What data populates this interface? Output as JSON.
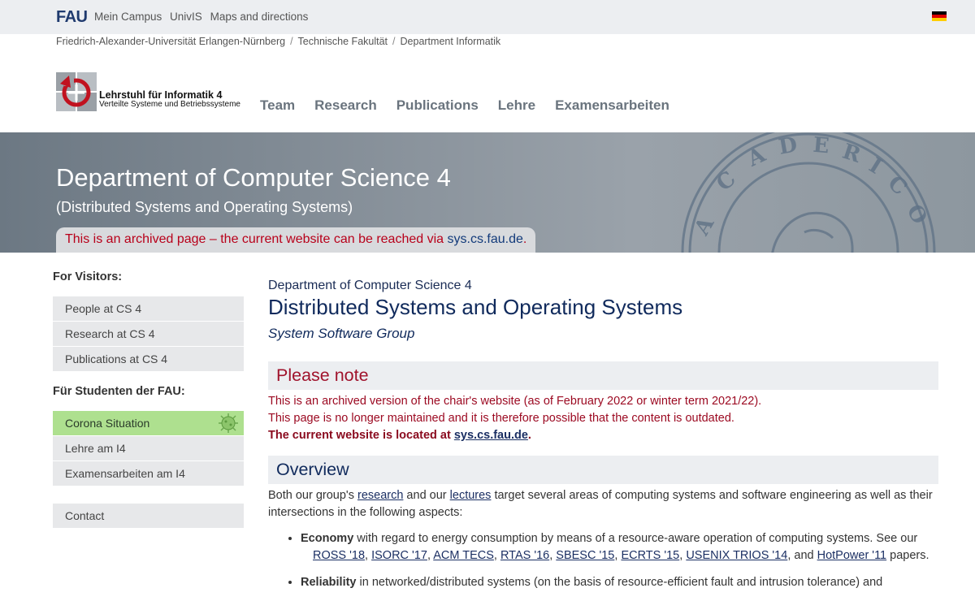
{
  "topbar": {
    "logo": "FAU",
    "links": [
      "Mein Campus",
      "UnivIS",
      "Maps and directions"
    ],
    "flag_colors": [
      "#000000",
      "#dd0000",
      "#ffce00"
    ]
  },
  "breadcrumb": [
    "Friedrich-Alexander-Universität Erlangen-Nürnberg",
    "Technische Fakultät",
    "Department Informatik"
  ],
  "chair": {
    "name": "Lehrstuhl für Informatik 4",
    "subtitle": "Verteilte Systeme und Betriebssysteme"
  },
  "nav": [
    "Team",
    "Research",
    "Publications",
    "Lehre",
    "Examensarbeiten"
  ],
  "hero": {
    "title": "Department of Computer Science 4",
    "subtitle": "(Distributed Systems and Operating Systems)",
    "banner_prefix": "This is an archived page – the current website can be reached via ",
    "banner_link": "sys.cs.fau.de",
    "banner_suffix": "."
  },
  "sidebar": {
    "visitors_heading": "For Visitors:",
    "visitors": [
      "People at CS 4",
      "Research at CS 4",
      "Publications at CS 4"
    ],
    "students_heading": "Für Studenten der FAU:",
    "students": [
      "Corona Situation",
      "Lehre am I4",
      "Examensarbeiten am I4"
    ],
    "contact": "Contact",
    "highlight_color": "#aee08f"
  },
  "main": {
    "kicker": "Department of Computer Science 4",
    "title": "Distributed Systems and Operating Systems",
    "subtitle": "System Software Group",
    "note": {
      "heading": "Please note",
      "line1": "This is an archived version of the chair's website (as of February 2022 or winter term 2021/22).",
      "line2": "This page is no longer maintained and it is therefore possible that the content is outdated.",
      "line3_prefix": "The current website is located at ",
      "line3_link": "sys.cs.fau.de",
      "line3_suffix": "."
    },
    "overview": {
      "heading": "Overview",
      "intro_1": "Both our group's ",
      "intro_link1": "research",
      "intro_2": " and our ",
      "intro_link2": "lectures",
      "intro_3": " target several areas of computing systems and software engineering as well as their intersections in the following aspects:",
      "b1_bold": "Economy",
      "b1_text": " with regard to energy consumption by means of a resource-aware operation of computing systems. See our",
      "b1_refs": [
        "ROSS '18",
        "ISORC '17",
        "ACM TECS",
        "RTAS '16",
        "SBESC '15",
        "ECRTS '15",
        "USENIX TRIOS '14"
      ],
      "b1_and": "and",
      "b1_last": "HotPower '11",
      "b1_tail": " papers.",
      "b2_bold": "Reliability",
      "b2_text": " in networked/distributed systems (on the basis of resource-efficient fault and intrusion tolerance) and"
    }
  }
}
